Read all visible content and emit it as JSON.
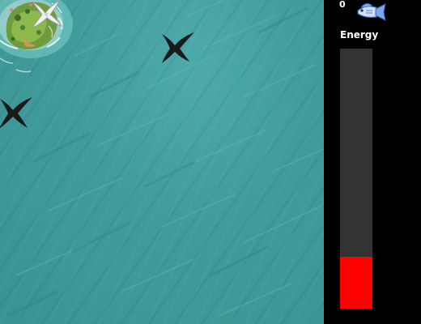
{
  "hud": {
    "score": "0",
    "score_icon": "fish-icon",
    "energy_label": "Energy",
    "energy_level": 0.2,
    "energy_color": "#ff0000",
    "energy_track_color": "#333333"
  },
  "scene": {
    "sea_color": "#3f9c9b",
    "island": "island-with-palm-trees",
    "player": "white-bird-icon",
    "enemies": [
      "black-bird-icon",
      "black-bird-icon"
    ]
  }
}
